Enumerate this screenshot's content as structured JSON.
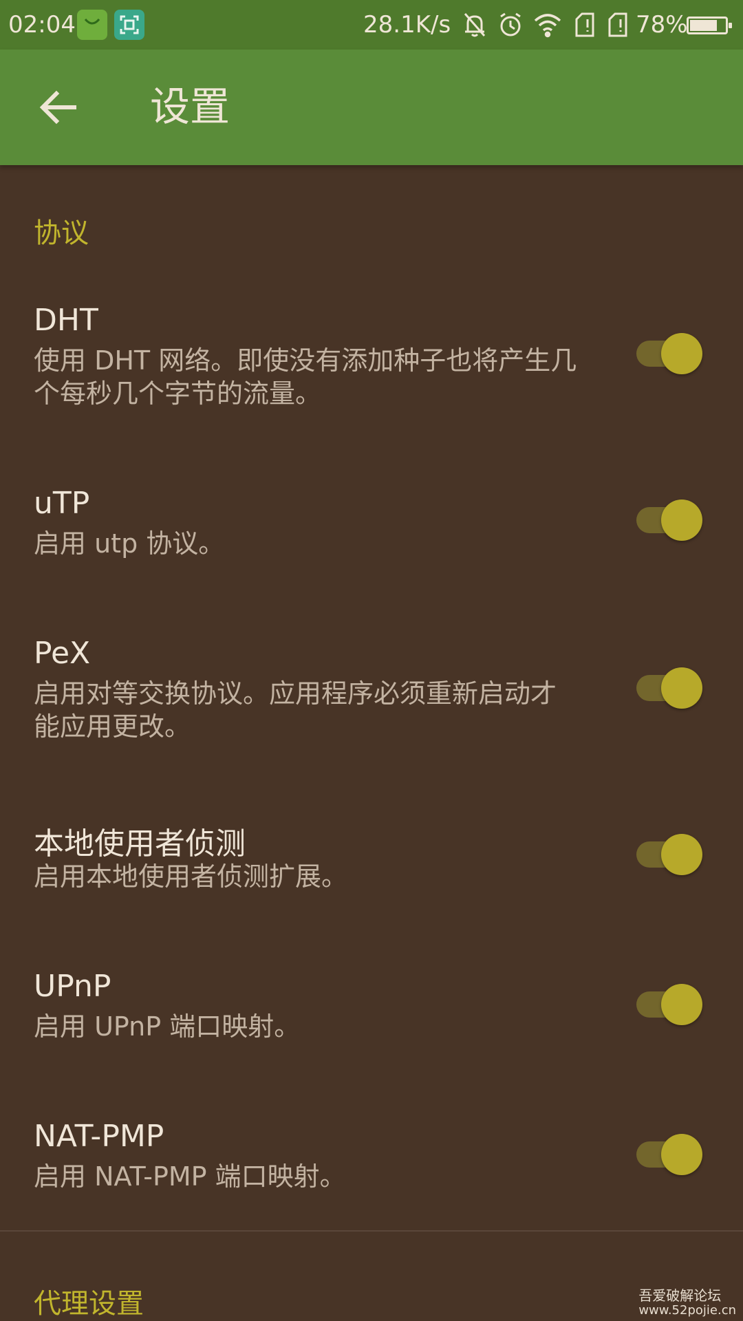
{
  "status_bar": {
    "time": "02:04",
    "net_speed": "28.1K/s",
    "battery_percent": "78%",
    "battery_level": 0.78,
    "icons": [
      "app-store-icon",
      "scan-icon",
      "mute-icon",
      "alarm-icon",
      "wifi-icon",
      "sim-icon",
      "sim-icon"
    ]
  },
  "app_bar": {
    "back_icon": "arrow-left-icon",
    "title": "设置"
  },
  "sections": [
    {
      "header": "协议",
      "items": [
        {
          "title": "DHT",
          "summary": "使用 DHT 网络。即使没有添加种子也将产生几个每秒几个字节的流量。",
          "enabled": true
        },
        {
          "title": "uTP",
          "summary": "启用 utp 协议。",
          "enabled": true
        },
        {
          "title": "PeX",
          "summary": "启用对等交换协议。应用程序必须重新启动才能应用更改。",
          "enabled": true
        },
        {
          "title": "本地使用者侦测",
          "summary": "启用本地使用者侦测扩展。",
          "enabled": true
        },
        {
          "title": "UPnP",
          "summary": "启用 UPnP 端口映射。",
          "enabled": true
        },
        {
          "title": "NAT-PMP",
          "summary": "启用 NAT-PMP 端口映射。",
          "enabled": true
        }
      ]
    },
    {
      "header": "代理设置",
      "items": []
    }
  ],
  "watermark": {
    "line1": "吾爱破解论坛",
    "line2": "www.52pojie.cn"
  },
  "colors": {
    "status_bar": "#4f7a2c",
    "app_bar": "#5a8c39",
    "background": "#483426",
    "accent": "#c1b52d",
    "switch_thumb": "#b7a92a"
  }
}
